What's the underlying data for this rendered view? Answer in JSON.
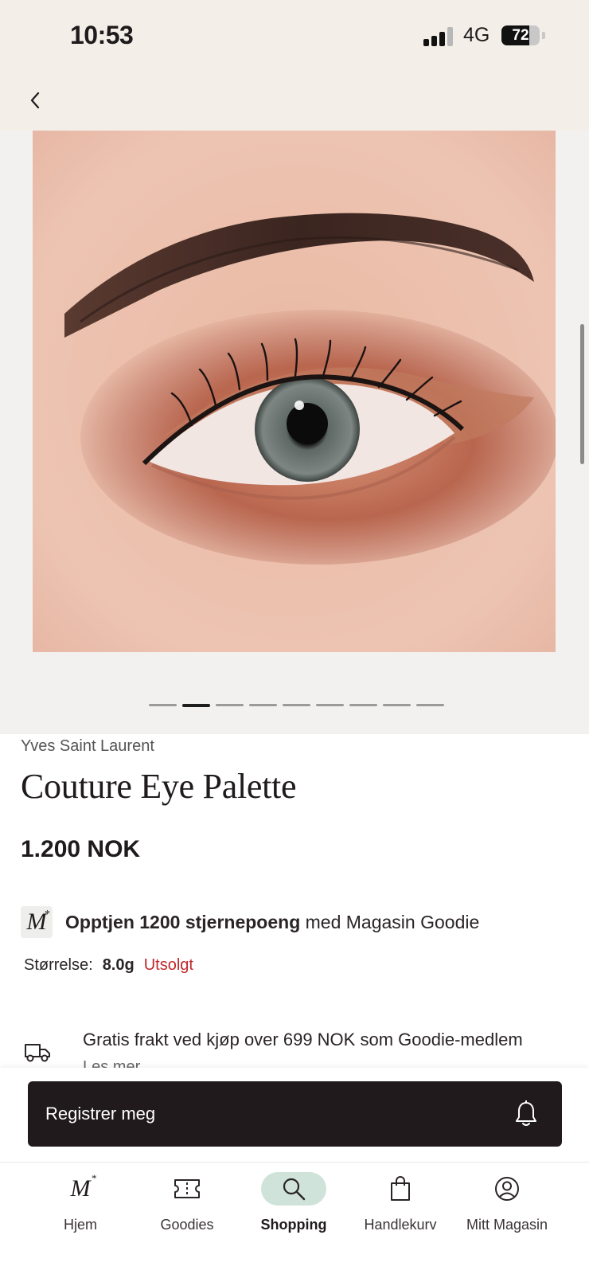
{
  "status_bar": {
    "time": "10:53",
    "network": "4G",
    "battery": "72",
    "battery_level": 0.72
  },
  "header": {
    "back_icon": "chevron-left-icon"
  },
  "gallery": {
    "image_description": "close-up eye with copper eyeshadow",
    "page_count": 9,
    "active_index": 1
  },
  "product": {
    "brand": "Yves Saint Laurent",
    "name": "Couture Eye Palette",
    "price": "1.200 NOK",
    "points_bold": "Opptjen 1200 stjernepoeng",
    "points_rest": " med Magasin Goodie",
    "size_label": "Størrelse:",
    "size_value": "8.0g",
    "size_status": "Utsolgt",
    "shipping_text": "Gratis frakt ved kjøp over 699 NOK som Goodie-medlem",
    "read_more": "Les mer"
  },
  "register": {
    "label": "Registrer meg",
    "icon": "bell-icon"
  },
  "tabs": [
    {
      "label": "Hjem",
      "icon": "magasin-logo-icon",
      "selected": false
    },
    {
      "label": "Goodies",
      "icon": "ticket-icon",
      "selected": false
    },
    {
      "label": "Shopping",
      "icon": "search-icon",
      "selected": true
    },
    {
      "label": "Handlekurv",
      "icon": "shopping-bag-icon",
      "selected": false
    },
    {
      "label": "Mitt Magasin",
      "icon": "user-circle-icon",
      "selected": false
    }
  ],
  "colors": {
    "header_bg": "#f3efe8",
    "primary_dark": "#211a1c",
    "sold_out_red": "#c0282d",
    "tab_selected_bg": "#cfe3da"
  }
}
